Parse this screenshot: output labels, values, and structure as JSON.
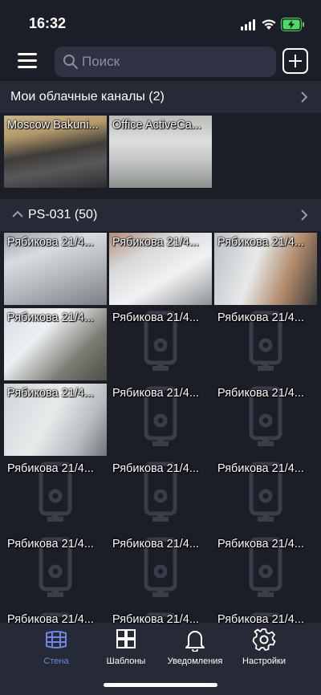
{
  "status": {
    "time": "16:32"
  },
  "search": {
    "placeholder": "Поиск"
  },
  "cloud_section": {
    "title": "Мои облачные каналы (2)",
    "tiles": [
      {
        "label": "Moscow Bakuni...",
        "feed": "street"
      },
      {
        "label": "Office ActiveCa...",
        "feed": "office"
      }
    ]
  },
  "ps_section": {
    "title": "PS-031 (50)",
    "tile_label": "Рябикова 21/4...",
    "tiles": [
      {
        "label": "Рябикова 21/4...",
        "feed": "snow"
      },
      {
        "label": "Рябикова 21/4...",
        "feed": "snow2"
      },
      {
        "label": "Рябикова 21/4...",
        "feed": "door"
      },
      {
        "label": "Рябикова 21/4...",
        "feed": "stairs"
      },
      {
        "label": "Рябикова 21/4...",
        "feed": "none"
      },
      {
        "label": "Рябикова 21/4...",
        "feed": "none"
      },
      {
        "label": "Рябикова 21/4...",
        "feed": "hall"
      },
      {
        "label": "Рябикова 21/4...",
        "feed": "none"
      },
      {
        "label": "Рябикова 21/4...",
        "feed": "none"
      },
      {
        "label": "Рябикова 21/4...",
        "feed": "none"
      },
      {
        "label": "Рябикова 21/4...",
        "feed": "none"
      },
      {
        "label": "Рябикова 21/4...",
        "feed": "none"
      },
      {
        "label": "Рябикова 21/4...",
        "feed": "none"
      },
      {
        "label": "Рябикова 21/4...",
        "feed": "none"
      },
      {
        "label": "Рябикова 21/4...",
        "feed": "none"
      },
      {
        "label": "Рябикова 21/4...",
        "feed": "none"
      },
      {
        "label": "Рябикова 21/4...",
        "feed": "none"
      },
      {
        "label": "Рябикова 21/4...",
        "feed": "none"
      }
    ]
  },
  "nav": [
    {
      "label": "Стена",
      "icon": "wall-grid-icon",
      "active": true
    },
    {
      "label": "Шаблоны",
      "icon": "templates-icon",
      "active": false
    },
    {
      "label": "Уведомления",
      "icon": "bell-icon",
      "active": false
    },
    {
      "label": "Настройки",
      "icon": "gear-icon",
      "active": false
    }
  ],
  "colors": {
    "background": "#1b1d27",
    "section_header": "#262936",
    "accent": "#6c86e3",
    "battery": "#4cd964"
  }
}
